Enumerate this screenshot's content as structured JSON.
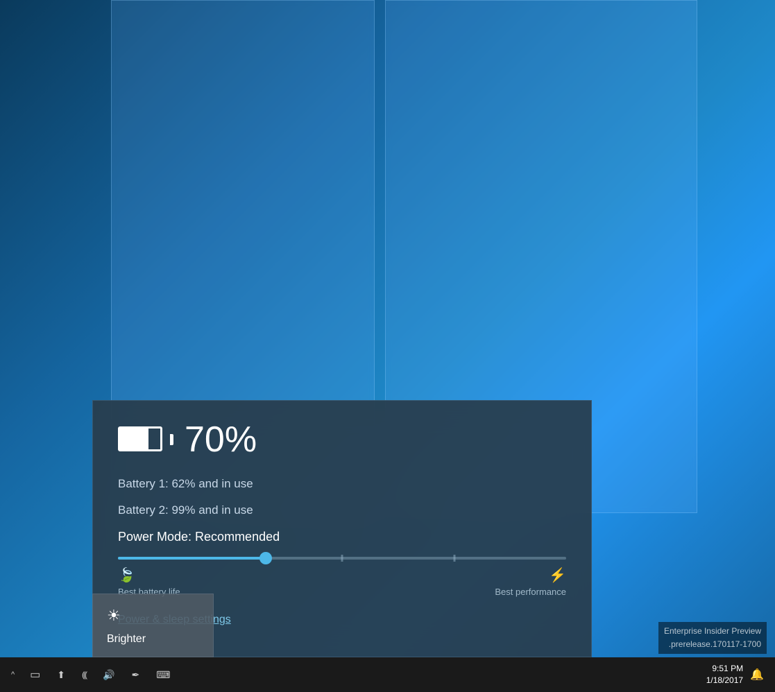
{
  "desktop": {
    "background": "windows10-blue"
  },
  "battery_popup": {
    "percentage": "70%",
    "battery1_label": "Battery 1: 62% and in use",
    "battery2_label": "Battery 2: 99% and in use",
    "power_mode_label": "Power Mode: Recommended",
    "power_settings_link": "Power & sleep settings",
    "slider": {
      "position_percent": 33,
      "left_icon": "🍃",
      "left_label": "Best battery life",
      "right_icon": "⚡",
      "right_label": "Best performance"
    }
  },
  "brighter_popup": {
    "icon": "☀",
    "label": "Brighter"
  },
  "win_version": {
    "line1": "Enterprise Insider Preview",
    "line2": ".prerelease.170117-1700"
  },
  "taskbar": {
    "time": "9:51 PM",
    "date": "1/18/2017",
    "chevron_label": "^",
    "icons": {
      "battery": "▭",
      "upload": "⬆",
      "wifi": "(((",
      "volume": "🔊",
      "pen": "✒",
      "keyboard": "⌨"
    },
    "notification_icon": "🔔"
  }
}
